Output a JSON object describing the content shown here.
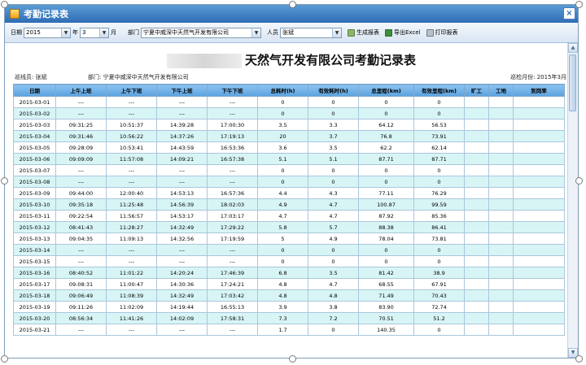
{
  "window": {
    "title": "考勤记录表",
    "close_label": "×"
  },
  "toolbar": {
    "date_label": "日期",
    "year_value": "2015",
    "year_unit": "年",
    "month_value": "3",
    "month_unit": "月",
    "dept_label": "部门",
    "dept_value": "宁夏中威深中天然气开发有限公司",
    "person_label": "人员",
    "person_value": "张斌",
    "generate_label": "生成报表",
    "export_label": "导出Excel",
    "print_label": "打印报表"
  },
  "report": {
    "title": "天然气开发有限公司考勤记录表",
    "person_line": "巡线员: 张斌",
    "dept_line": "部门: 宁夏中威深中天然气开发有限公司",
    "month_line": "巡检月份: 2015年3月",
    "columns": [
      "日期",
      "上午上班",
      "上午下班",
      "下午上班",
      "下午下班",
      "总耗时(h)",
      "有效耗时(h)",
      "总里程(km)",
      "有效里程(km)",
      "旷工",
      "工地",
      "到岗率"
    ],
    "rows": [
      [
        "2015-03-01",
        "---",
        "---",
        "---",
        "---",
        "0",
        "0",
        "0",
        "0",
        "",
        "",
        ""
      ],
      [
        "2015-03-02",
        "---",
        "---",
        "---",
        "---",
        "0",
        "0",
        "0",
        "0",
        "",
        "",
        ""
      ],
      [
        "2015-03-03",
        "09:31:25",
        "10:51:37",
        "14:39:28",
        "17:00:30",
        "3.5",
        "3.3",
        "64.12",
        "56.53",
        "",
        "",
        ""
      ],
      [
        "2015-03-04",
        "09:31:46",
        "10:56:22",
        "14:37:26",
        "17:19:13",
        "20",
        "3.7",
        "76.8",
        "73.91",
        "",
        "",
        ""
      ],
      [
        "2015-03-05",
        "09:28:09",
        "10:53:41",
        "14:43:59",
        "16:53:36",
        "3.6",
        "3.5",
        "62.2",
        "62.14",
        "",
        "",
        ""
      ],
      [
        "2015-03-06",
        "09:09:09",
        "11:57:08",
        "14:09:21",
        "16:57:38",
        "5.1",
        "5.1",
        "87.71",
        "87.71",
        "",
        "",
        ""
      ],
      [
        "2015-03-07",
        "---",
        "---",
        "---",
        "---",
        "0",
        "0",
        "0",
        "0",
        "",
        "",
        ""
      ],
      [
        "2015-03-08",
        "---",
        "---",
        "---",
        "---",
        "0",
        "0",
        "0",
        "0",
        "",
        "",
        ""
      ],
      [
        "2015-03-09",
        "09:44:00",
        "12:00:40",
        "14:53:13",
        "16:57:36",
        "4.4",
        "4.3",
        "77.11",
        "76.29",
        "",
        "",
        ""
      ],
      [
        "2015-03-10",
        "09:35:18",
        "11:25:48",
        "14:56:39",
        "18:02:03",
        "4.9",
        "4.7",
        "100.87",
        "99.59",
        "",
        "",
        ""
      ],
      [
        "2015-03-11",
        "09:22:54",
        "11:56:57",
        "14:53:17",
        "17:03:17",
        "4.7",
        "4.7",
        "87.92",
        "85.36",
        "",
        "",
        ""
      ],
      [
        "2015-03-12",
        "08:41:43",
        "11:28:27",
        "14:32:49",
        "17:29:22",
        "5.8",
        "5.7",
        "88.38",
        "86.41",
        "",
        "",
        ""
      ],
      [
        "2015-03-13",
        "09:04:35",
        "11:09:13",
        "14:32:56",
        "17:19:59",
        "5",
        "4.9",
        "78.04",
        "73.81",
        "",
        "",
        ""
      ],
      [
        "2015-03-14",
        "---",
        "---",
        "---",
        "---",
        "0",
        "0",
        "0",
        "0",
        "",
        "",
        ""
      ],
      [
        "2015-03-15",
        "---",
        "---",
        "---",
        "---",
        "0",
        "0",
        "0",
        "0",
        "",
        "",
        ""
      ],
      [
        "2015-03-16",
        "08:40:52",
        "11:01:22",
        "14:20:24",
        "17:46:39",
        "6.8",
        "3.5",
        "81.42",
        "38.9",
        "",
        "",
        ""
      ],
      [
        "2015-03-17",
        "09:08:31",
        "11:00:47",
        "14:30:36",
        "17:24:21",
        "4.8",
        "4.7",
        "68.55",
        "67.91",
        "",
        "",
        ""
      ],
      [
        "2015-03-18",
        "09:06:49",
        "11:08:39",
        "14:32:49",
        "17:03:42",
        "4.8",
        "4.8",
        "71.49",
        "70.43",
        "",
        "",
        ""
      ],
      [
        "2015-03-19",
        "09:11:26",
        "11:02:09",
        "14:19:44",
        "16:55:13",
        "3.9",
        "3.8",
        "83.90",
        "72.74",
        "",
        "",
        ""
      ],
      [
        "2015-03-20",
        "08:56:34",
        "11:41:26",
        "14:02:09",
        "17:58:31",
        "7.3",
        "7.2",
        "70.51",
        "51.2",
        "",
        "",
        ""
      ],
      [
        "2015-03-21",
        "---",
        "---",
        "---",
        "---",
        "1.7",
        "0",
        "140.35",
        "0",
        "",
        "",
        ""
      ]
    ]
  },
  "icons": {
    "dropdown": "chevron-down-icon",
    "generate": "report-icon",
    "export": "excel-icon",
    "print": "printer-icon"
  }
}
